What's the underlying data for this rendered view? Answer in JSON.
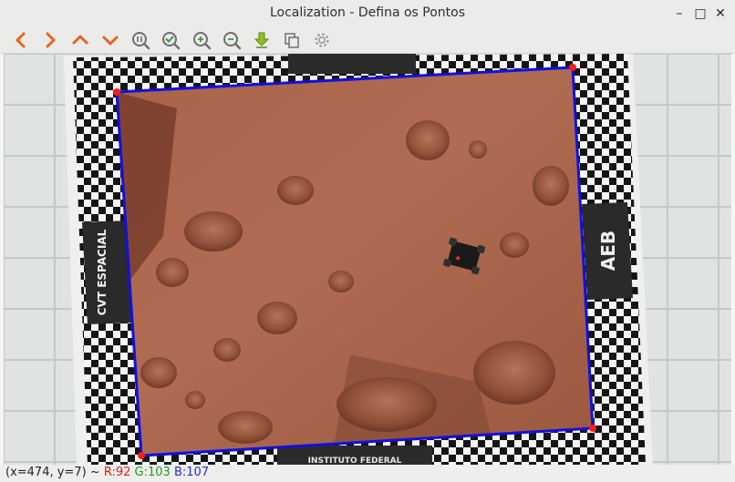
{
  "window": {
    "title": "Localization - Defina os Pontos",
    "minimize_label": "–",
    "maximize_label": "□",
    "close_label": "✕"
  },
  "toolbar": {
    "buttons": [
      {
        "name": "pan-left-icon"
      },
      {
        "name": "pan-right-icon"
      },
      {
        "name": "pan-up-icon"
      },
      {
        "name": "pan-down-icon"
      },
      {
        "name": "zoom-reset-icon"
      },
      {
        "name": "zoom-fit-icon"
      },
      {
        "name": "zoom-in-icon"
      },
      {
        "name": "zoom-out-icon"
      },
      {
        "name": "save-icon"
      },
      {
        "name": "copy-icon"
      },
      {
        "name": "settings-icon"
      }
    ],
    "colors": {
      "arrow": "#e8641f",
      "green": "#3e9a3a",
      "grey": "#6f6f6f",
      "save": "#8fbf27"
    }
  },
  "image": {
    "mat_texts": {
      "right_logo": "AEB",
      "left_logo": "CVT ESPACIAL",
      "bottom_text": "INSTITUTO FEDERAL"
    },
    "polygon_color": "#1010e0",
    "point_color": "#ff1a1a"
  },
  "status": {
    "coords": "(x=474, y=7) ~",
    "r_label": "R:92",
    "g_label": "G:103",
    "b_label": "B:107",
    "r_color": "#e01b1b",
    "g_color": "#1c9a1c",
    "b_color": "#2030c8"
  }
}
